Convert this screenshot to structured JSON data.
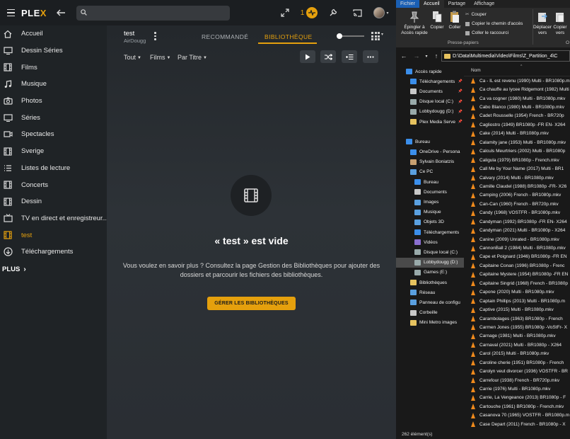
{
  "plex": {
    "logo": {
      "prefix": "PLE",
      "accent": "X"
    },
    "search_placeholder": "",
    "activity_count": "1",
    "accent_color": "#e5a00d",
    "sidebar": [
      {
        "label": "Accueil",
        "icon": "home-icon"
      },
      {
        "label": "Dessin Séries",
        "icon": "tv-icon"
      },
      {
        "label": "Films",
        "icon": "film-icon"
      },
      {
        "label": "Musique",
        "icon": "music-icon"
      },
      {
        "label": "Photos",
        "icon": "camera-icon"
      },
      {
        "label": "Séries",
        "icon": "tv-icon"
      },
      {
        "label": "Spectacles",
        "icon": "video-icon"
      },
      {
        "label": "Sverige",
        "icon": "film-icon"
      },
      {
        "label": "Listes de lecture",
        "icon": "list-icon"
      },
      {
        "label": "Concerts",
        "icon": "film-icon"
      },
      {
        "label": "Dessin",
        "icon": "film-icon"
      },
      {
        "label": "TV en direct et enregistreur...",
        "icon": "live-tv-icon"
      },
      {
        "label": "test",
        "icon": "film-icon",
        "active": true
      },
      {
        "label": "Téléchargements",
        "icon": "download-icon"
      }
    ],
    "plus_label": "PLUS",
    "library": {
      "title": "test",
      "server": "AirDougg",
      "tab_recommended": "RECOMMANDÉ",
      "tab_library": "BIBLIOTHÈQUE",
      "filter_all": "Tout",
      "filter_type": "Films",
      "filter_sort": "Par Titre"
    },
    "empty": {
      "title": "« test » est vide",
      "text": "Vous voulez en savoir plus ? Consultez la page Gestion des Bibliothèques pour ajouter des dossiers et parcourir les fichiers des bibliothèques.",
      "button": "GÉRER LES BIBLIOTHÈQUES"
    }
  },
  "explorer": {
    "tabs": [
      "Fichier",
      "Accueil",
      "Partage",
      "Affichage"
    ],
    "ribbon": {
      "pin": "Épingler à\nAccès rapide",
      "copy": "Copier",
      "paste": "Coller",
      "cut": "Couper",
      "copy_path": "Copier le chemin d'accès",
      "paste_shortcut": "Coller le raccourci",
      "group": "Presse-papiers",
      "move": "Déplacer\nvers",
      "copy_to": "Copier\nvers",
      "org": "O"
    },
    "address": "D:\\Data\\Multimedia\\Video\\Films\\Z_Partition_4\\C",
    "column_name": "Nom",
    "tree": [
      {
        "label": "Accès rapide",
        "indent": 14,
        "color": "#3b8eea"
      },
      {
        "label": "Téléchargements",
        "indent": 20,
        "color": "#3b8eea",
        "pin": true
      },
      {
        "label": "Documents",
        "indent": 20,
        "color": "#c8c8c8",
        "pin": true
      },
      {
        "label": "Disque local (C:)",
        "indent": 20,
        "color": "#9aa",
        "pin": true
      },
      {
        "label": "Lobbydougg (D:)",
        "indent": 20,
        "color": "#9aa",
        "pin": true
      },
      {
        "label": "Plex Media Serve",
        "indent": 20,
        "color": "#e7c35f",
        "pin": true
      },
      {
        "label": "",
        "indent": 20,
        "color": "transparent"
      },
      {
        "label": "Bureau",
        "indent": 14,
        "color": "#3b8eea"
      },
      {
        "label": "OneDrive - Persona",
        "indent": 20,
        "color": "#3b8eea"
      },
      {
        "label": "Sylvain Boniatzis",
        "indent": 20,
        "color": "#c8a070"
      },
      {
        "label": "Ce PC",
        "indent": 20,
        "color": "#5aa0e0"
      },
      {
        "label": "Bureau",
        "indent": 26,
        "color": "#3b8eea"
      },
      {
        "label": "Documents",
        "indent": 26,
        "color": "#c8c8c8"
      },
      {
        "label": "Images",
        "indent": 26,
        "color": "#5aa0e0"
      },
      {
        "label": "Musique",
        "indent": 26,
        "color": "#5aa0e0"
      },
      {
        "label": "Objets 3D",
        "indent": 26,
        "color": "#5aa0e0"
      },
      {
        "label": "Téléchargements",
        "indent": 26,
        "color": "#3b8eea"
      },
      {
        "label": "Vidéos",
        "indent": 26,
        "color": "#8a6fd0"
      },
      {
        "label": "Disque local (C:)",
        "indent": 26,
        "color": "#9aa"
      },
      {
        "label": "Lobbydougg (D:)",
        "indent": 26,
        "color": "#9aa",
        "selected": true
      },
      {
        "label": "Games (E:)",
        "indent": 26,
        "color": "#9aa"
      },
      {
        "label": "Bibliothèques",
        "indent": 20,
        "color": "#e7c35f"
      },
      {
        "label": "Réseau",
        "indent": 20,
        "color": "#5aa0e0"
      },
      {
        "label": "Panneau de configu",
        "indent": 20,
        "color": "#5aa0e0"
      },
      {
        "label": "Corbeille",
        "indent": 20,
        "color": "#c8c8c8"
      },
      {
        "label": "Mini Metro images",
        "indent": 20,
        "color": "#e7c35f"
      }
    ],
    "files": [
      "Ca - IL est revenu (1990) Multi - BR1080p.mkv",
      "Ca chauffe au lycee Ridgemont (1982) Multi",
      "Ca va cogner (1980) Multi - BR1080p.mkv",
      "Cabo Blanco (1980) Multi - BR1080p.mkv",
      "Cadet Rousselle (1954) French - BR720p",
      "Cagliostro (1949) BR1080p -FR EN- X264",
      "Cake (2014) Multi - BR1080p.mkv",
      "Calamity jane (1953) Multi - BR1080p.mkv",
      "Calculs Meurtriers (2002) Multi - BR1080p",
      "Caligula (1979) BR1080p - French.mkv",
      "Call Me by Your Name (2017) Multi - BR1",
      "Calvary (2014) Multi - BR1080p.mkv",
      "Camille Claudel (1988) BR1080p -FR- X26",
      "Camping (2006) French - BR1080p.mkv",
      "Can-Can (1960) French - BR720p.mkv",
      "Candy (1968) VOSTFR - BR1080p.mkv",
      "Candyman (1992) BR1080p -FR EN- X264",
      "Candyman (2021) Multi - BR1080p - X264",
      "Canine (2009) Unrated - BR1080p.mkv",
      "CannonBall 2 (1984) Multi - BR1080p.mkv",
      "Cape et Poignard (1946) BR1080p -FR EN",
      "Capitaine Conan (1996) BR1080p - Frenc",
      "Capitaine Mystere (1954) BR1080p -FR EN",
      "Capitaine Singrid (1968) French - BR1080p",
      "Capone (2020) Multi - BR1080p.mkv",
      "Captain Phillips (2013) Multi - BR1080p.m",
      "Captive (2015) Multi - BR1080p.mkv",
      "Carambolages (1963) BR1080p - French",
      "Carmen Jones (1955) BR1080p -VoStFr- X",
      "Carnage (1981) Multi - BR1080p.mkv",
      "Carnaval (2021) Multi - BR1080p - X264",
      "Carol (2015) Multi - BR1080p.mkv",
      "Caroline cherie (1951) BR1080p - French",
      "Carolyn veut divorcer (1936) VOSTFR - BR",
      "Carrefour (1938) French - BR720p.mkv",
      "Carrie (1976) Multi - BR1080p.mkv",
      "Carrie, La Vengeance (2013) BR1080p - F",
      "Cartouche (1961) BR1080p - French.mkv",
      "Casanova 70 (1965) VOSTFR - BR1080p.m",
      "Case Depart (2011) French - BR1080p - X"
    ],
    "status": "262 élément(s)"
  }
}
